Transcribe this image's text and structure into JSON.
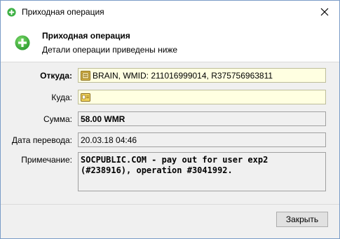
{
  "window": {
    "title": "Приходная операция"
  },
  "header": {
    "title": "Приходная операция",
    "subtitle": "Детали операции приведены ниже"
  },
  "form": {
    "from": {
      "label": "Откуда:",
      "value": "BRAIN, WMID: 211016999014, R375756963811"
    },
    "to": {
      "label": "Куда:",
      "value": ""
    },
    "amount": {
      "label": "Сумма:",
      "value": "58.00 WMR"
    },
    "date": {
      "label": "Дата перевода:",
      "value": "20.03.18 04:46"
    },
    "note": {
      "label": "Примечание:",
      "value": "SOCPUBLIC.COM - pay out for user exp2 (#238916), operation #3041992."
    }
  },
  "footer": {
    "close_label": "Закрыть"
  },
  "colors": {
    "accent_green": "#3cb043",
    "field_yellow": "#ffffe1"
  },
  "icons": [
    "add-circle-icon",
    "close-icon",
    "wallet-icon",
    "wallet-card-icon"
  ]
}
